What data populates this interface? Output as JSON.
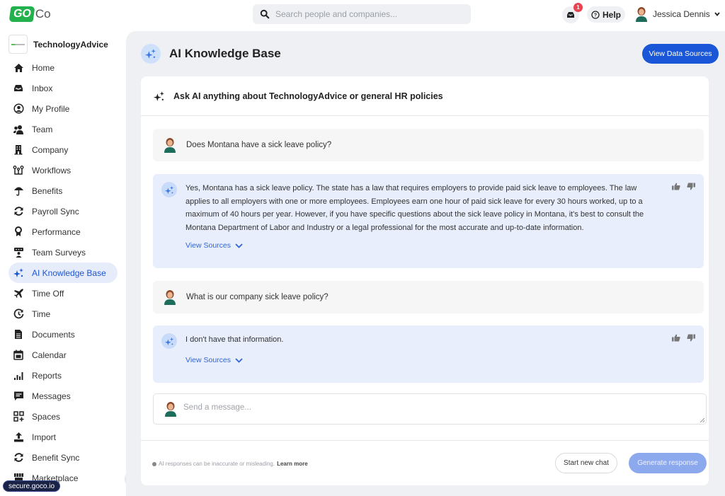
{
  "header": {
    "logo_part1": "GO",
    "logo_part2": "Co",
    "search_placeholder": "Search people and companies...",
    "inbox_badge_count": "1",
    "help_label": "Help",
    "user_name": "Jessica Dennis"
  },
  "sidebar": {
    "org_name": "TechnologyAdvice",
    "items": [
      {
        "label": "Home",
        "icon": "home-icon"
      },
      {
        "label": "Inbox",
        "icon": "inbox-icon"
      },
      {
        "label": "My Profile",
        "icon": "profile-icon"
      },
      {
        "label": "Team",
        "icon": "team-icon"
      },
      {
        "label": "Company",
        "icon": "building-icon"
      },
      {
        "label": "Workflows",
        "icon": "workflow-icon"
      },
      {
        "label": "Benefits",
        "icon": "umbrella-icon"
      },
      {
        "label": "Payroll Sync",
        "icon": "sync-icon"
      },
      {
        "label": "Performance",
        "icon": "award-icon"
      },
      {
        "label": "Team Surveys",
        "icon": "survey-icon"
      },
      {
        "label": "AI Knowledge Base",
        "icon": "sparkle-icon",
        "active": true
      },
      {
        "label": "Time Off",
        "icon": "plane-icon"
      },
      {
        "label": "Time",
        "icon": "clock-icon"
      },
      {
        "label": "Documents",
        "icon": "document-icon"
      },
      {
        "label": "Calendar",
        "icon": "calendar-icon"
      },
      {
        "label": "Reports",
        "icon": "chart-icon"
      },
      {
        "label": "Messages",
        "icon": "message-icon"
      },
      {
        "label": "Spaces",
        "icon": "spaces-icon"
      },
      {
        "label": "Import",
        "icon": "upload-icon"
      },
      {
        "label": "Benefit Sync",
        "icon": "sync-icon"
      },
      {
        "label": "Marketplace",
        "icon": "store-icon"
      }
    ],
    "url_chip": "secure.goco.io"
  },
  "main": {
    "title": "AI Knowledge Base",
    "view_data_sources_label": "View Data Sources",
    "prompt_heading": "Ask AI anything about TechnologyAdvice or general HR policies",
    "messages": [
      {
        "role": "user",
        "text": "Does Montana have a sick leave policy?"
      },
      {
        "role": "ai",
        "text": "Yes, Montana has a sick leave policy. The state has a law that requires employers to provide paid sick leave to employees. The law applies to all employers with one or more employees. Employees earn one hour of paid sick leave for every 30 hours worked, up to a maximum of 40 hours per year. However, if you have specific questions about the sick leave policy in Montana, it's best to consult the Montana Department of Labor and Industry or a legal professional for the most accurate and up-to-date information.",
        "sources_label": "View Sources"
      },
      {
        "role": "user",
        "text": "What is our company sick leave policy?"
      },
      {
        "role": "ai",
        "text": "I don't have that information.",
        "sources_label": "View Sources"
      }
    ],
    "input_placeholder": "Send a message...",
    "disclaimer": "AI responses can be inaccurate or misleading.",
    "learn_more": "Learn more",
    "start_new_chat_label": "Start new chat",
    "generate_response_label": "Generate response"
  }
}
